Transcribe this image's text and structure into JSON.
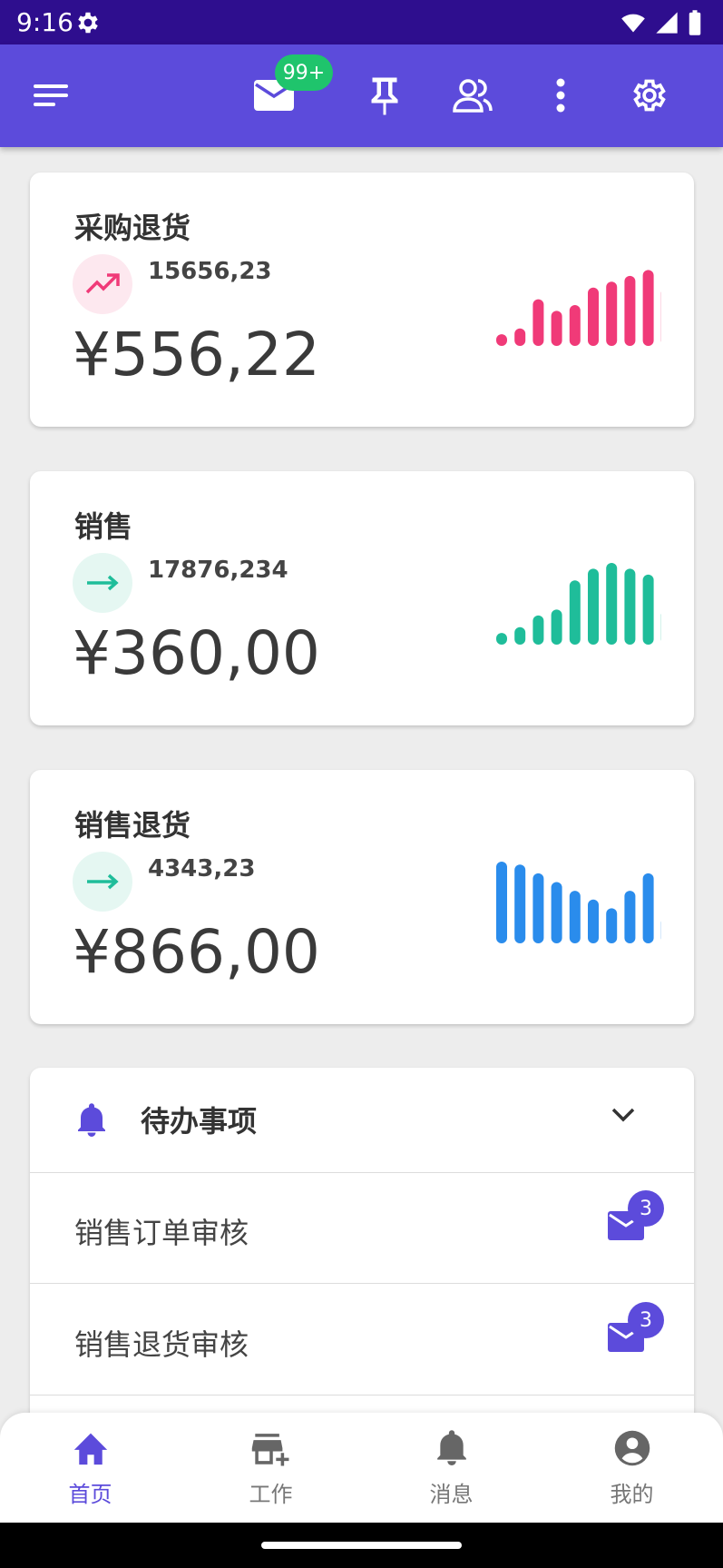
{
  "status_bar": {
    "time": "9:16"
  },
  "app_bar": {
    "mail_badge": "99+"
  },
  "cards": [
    {
      "title": "采购退货",
      "sub_value": "15656,23",
      "amount": "¥556,22",
      "trend": "up",
      "color": "#f03a78",
      "bg": "#fde8ef",
      "bars": [
        2,
        3,
        8,
        6,
        7,
        10,
        11,
        12,
        13,
        10
      ]
    },
    {
      "title": "销售",
      "sub_value": "17876,234",
      "amount": "¥360,00",
      "trend": "flat",
      "color": "#1fbd9a",
      "bg": "#e5f7f2",
      "bars": [
        2,
        3,
        5,
        6,
        11,
        13,
        14,
        13,
        12,
        6
      ]
    },
    {
      "title": "销售退货",
      "sub_value": "4343,23",
      "amount": "¥866,00",
      "trend": "flat",
      "color": "#2a8cec",
      "bg": "#e5f7f2",
      "trend_color": "#1fbd9a",
      "bars": [
        14,
        13.5,
        12,
        10.5,
        9,
        7.5,
        6,
        9,
        12,
        4.5
      ]
    }
  ],
  "todo": {
    "header": "待办事项",
    "items": [
      {
        "label": "销售订单审核",
        "count": "3"
      },
      {
        "label": "销售退货审核",
        "count": "3"
      }
    ]
  },
  "bottom_nav": [
    {
      "label": "首页",
      "icon": "home-icon",
      "active": true
    },
    {
      "label": "工作",
      "icon": "store-add-icon",
      "active": false
    },
    {
      "label": "消息",
      "icon": "bell-icon",
      "active": false
    },
    {
      "label": "我的",
      "icon": "account-icon",
      "active": false
    }
  ],
  "colors": {
    "primary": "#5c4bdb",
    "status_bar": "#2e0e8e",
    "badge_green": "#1fc46c"
  }
}
